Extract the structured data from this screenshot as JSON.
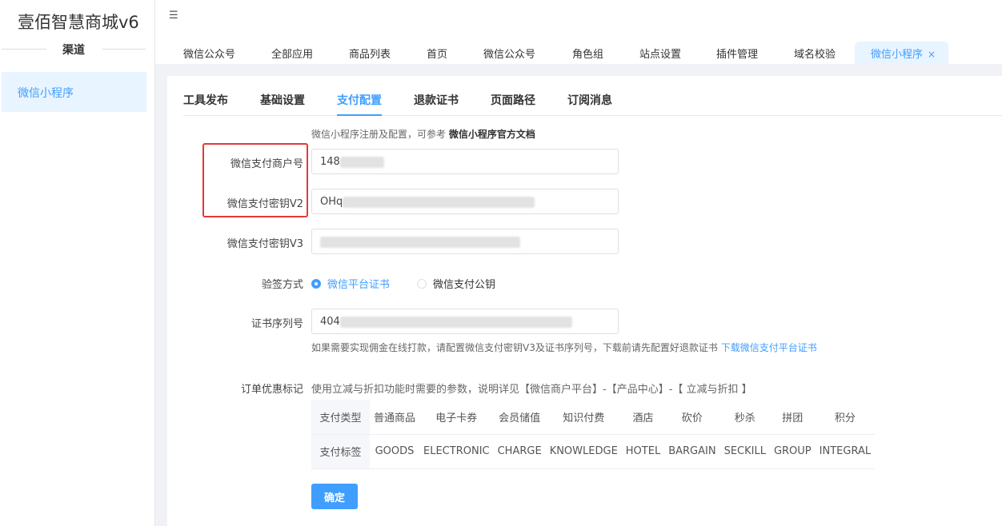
{
  "sidebar": {
    "brand": "壹佰智慧商城v6",
    "channel_label": "渠道",
    "item": "微信小程序"
  },
  "topbar": {
    "menu_icon": "menu-fold-icon",
    "tabs": [
      "微信公众号",
      "全部应用",
      "商品列表",
      "首页",
      "微信公众号",
      "角色组",
      "站点设置",
      "插件管理",
      "域名校验",
      "微信小程序"
    ],
    "close_icon": "×"
  },
  "subtabs": [
    "工具发布",
    "基础设置",
    "支付配置",
    "退款证书",
    "页面路径",
    "订阅消息"
  ],
  "form": {
    "intro_text": "微信小程序注册及配置，可参考",
    "intro_link": "微信小程序官方文档",
    "merchant_label": "微信支付商户号",
    "merchant_value": "148",
    "key_v2_label": "微信支付密钥V2",
    "key_v2_value": "OHq",
    "key_v3_label": "微信支付密钥V3",
    "sign_label": "验签方式",
    "sign_option_1": "微信平台证书",
    "sign_option_2": "微信支付公钥",
    "serial_label": "证书序列号",
    "serial_value": "404",
    "serial_hint": "如果需要实现佣金在线打款，请配置微信支付密钥V3及证书序列号，下载前请先配置好退款证书",
    "serial_hint_link": "下载微信支付平台证书",
    "discount_label": "订单优惠标记",
    "discount_hint": "使用立减与折扣功能时需要的参数，说明详见【微信商户平台】-【产品中心】-【 立减与折扣 】",
    "confirm": "确定"
  },
  "pay_table": {
    "row1_head": "支付类型",
    "row1": [
      "普通商品",
      "电子卡券",
      "会员储值",
      "知识付费",
      "酒店",
      "砍价",
      "秒杀",
      "拼团",
      "积分"
    ],
    "row2_head": "支付标签",
    "row2": [
      "GOODS",
      "ELECTRONIC",
      "CHARGE",
      "KNOWLEDGE",
      "HOTEL",
      "BARGAIN",
      "SECKILL",
      "GROUP",
      "INTEGRAL"
    ]
  },
  "colors": {
    "accent": "#409eff",
    "highlight_box": "#e53935"
  }
}
